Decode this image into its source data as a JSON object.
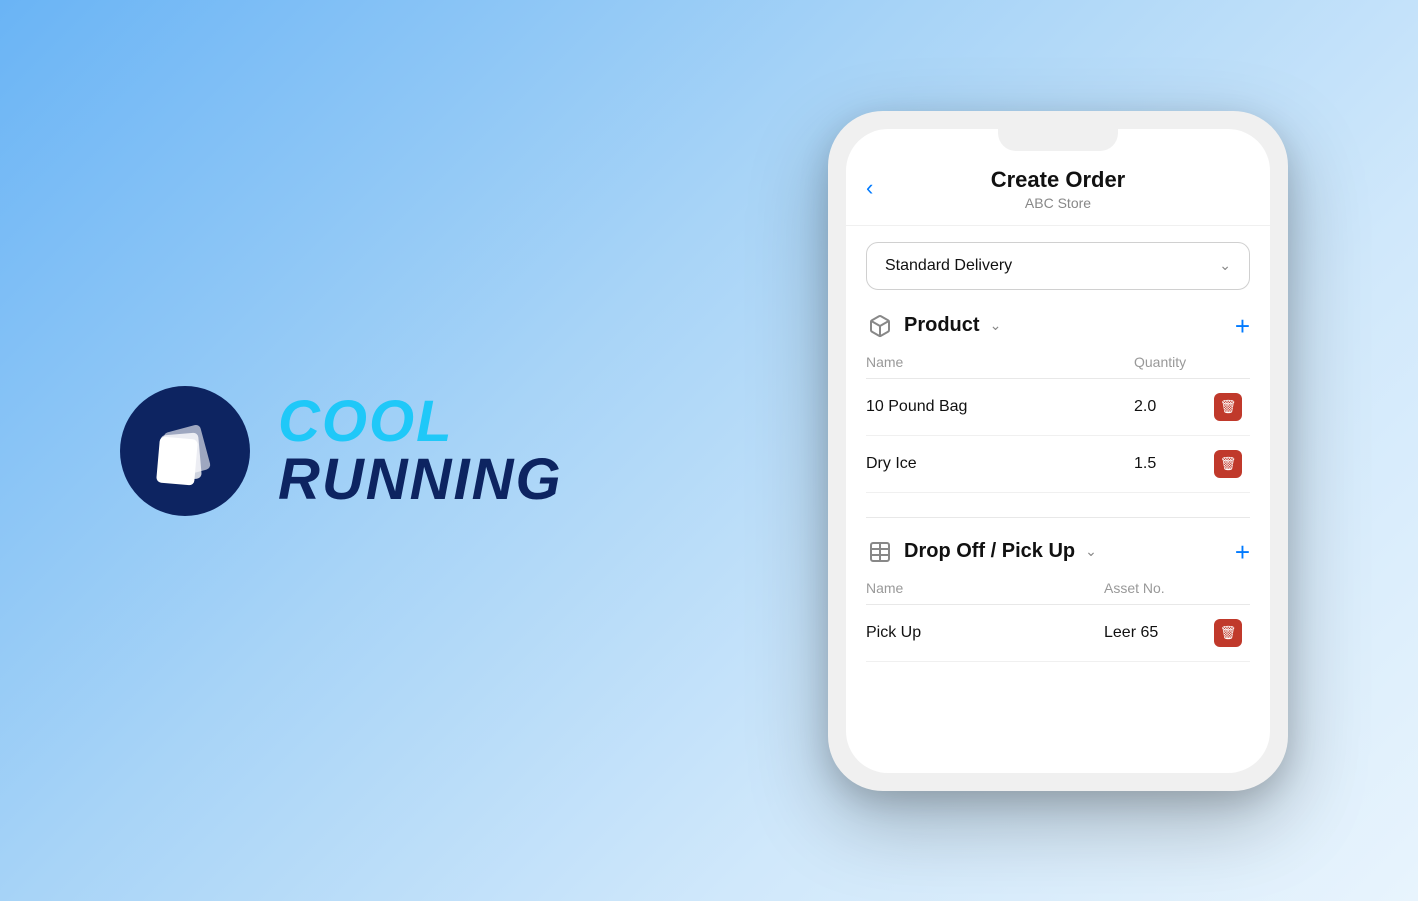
{
  "background": {
    "gradient_start": "#6ab4f5",
    "gradient_end": "#e8f4fd"
  },
  "logo": {
    "cool_text": "COOL",
    "running_text": "RUNNING",
    "brand_color": "#1fc8f8",
    "dark_color": "#0d2461"
  },
  "phone": {
    "header": {
      "title": "Create Order",
      "subtitle": "ABC Store",
      "back_label": "‹"
    },
    "delivery_dropdown": {
      "value": "Standard Delivery",
      "chevron": "›"
    },
    "product_section": {
      "title": "Product",
      "expand_icon": "˅",
      "add_icon": "+",
      "columns": {
        "name": "Name",
        "quantity": "Quantity"
      },
      "items": [
        {
          "name": "10 Pound Bag",
          "quantity": "2.0"
        },
        {
          "name": "Dry Ice",
          "quantity": "1.5"
        }
      ]
    },
    "dropoff_section": {
      "title": "Drop Off / Pick Up",
      "expand_icon": "˅",
      "add_icon": "+",
      "columns": {
        "name": "Name",
        "asset": "Asset No."
      },
      "items": [
        {
          "name": "Pick Up",
          "asset": "Leer 65"
        }
      ]
    }
  }
}
